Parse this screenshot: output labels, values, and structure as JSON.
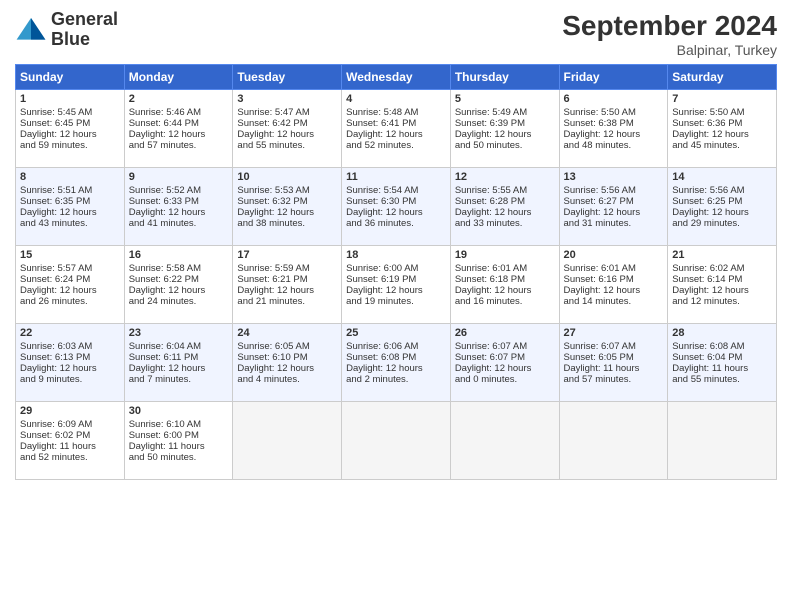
{
  "header": {
    "logo_line1": "General",
    "logo_line2": "Blue",
    "month": "September 2024",
    "location": "Balpinar, Turkey"
  },
  "days_of_week": [
    "Sunday",
    "Monday",
    "Tuesday",
    "Wednesday",
    "Thursday",
    "Friday",
    "Saturday"
  ],
  "weeks": [
    [
      {
        "day": "1",
        "lines": [
          "Sunrise: 5:45 AM",
          "Sunset: 6:45 PM",
          "Daylight: 12 hours",
          "and 59 minutes."
        ]
      },
      {
        "day": "2",
        "lines": [
          "Sunrise: 5:46 AM",
          "Sunset: 6:44 PM",
          "Daylight: 12 hours",
          "and 57 minutes."
        ]
      },
      {
        "day": "3",
        "lines": [
          "Sunrise: 5:47 AM",
          "Sunset: 6:42 PM",
          "Daylight: 12 hours",
          "and 55 minutes."
        ]
      },
      {
        "day": "4",
        "lines": [
          "Sunrise: 5:48 AM",
          "Sunset: 6:41 PM",
          "Daylight: 12 hours",
          "and 52 minutes."
        ]
      },
      {
        "day": "5",
        "lines": [
          "Sunrise: 5:49 AM",
          "Sunset: 6:39 PM",
          "Daylight: 12 hours",
          "and 50 minutes."
        ]
      },
      {
        "day": "6",
        "lines": [
          "Sunrise: 5:50 AM",
          "Sunset: 6:38 PM",
          "Daylight: 12 hours",
          "and 48 minutes."
        ]
      },
      {
        "day": "7",
        "lines": [
          "Sunrise: 5:50 AM",
          "Sunset: 6:36 PM",
          "Daylight: 12 hours",
          "and 45 minutes."
        ]
      }
    ],
    [
      {
        "day": "8",
        "lines": [
          "Sunrise: 5:51 AM",
          "Sunset: 6:35 PM",
          "Daylight: 12 hours",
          "and 43 minutes."
        ]
      },
      {
        "day": "9",
        "lines": [
          "Sunrise: 5:52 AM",
          "Sunset: 6:33 PM",
          "Daylight: 12 hours",
          "and 41 minutes."
        ]
      },
      {
        "day": "10",
        "lines": [
          "Sunrise: 5:53 AM",
          "Sunset: 6:32 PM",
          "Daylight: 12 hours",
          "and 38 minutes."
        ]
      },
      {
        "day": "11",
        "lines": [
          "Sunrise: 5:54 AM",
          "Sunset: 6:30 PM",
          "Daylight: 12 hours",
          "and 36 minutes."
        ]
      },
      {
        "day": "12",
        "lines": [
          "Sunrise: 5:55 AM",
          "Sunset: 6:28 PM",
          "Daylight: 12 hours",
          "and 33 minutes."
        ]
      },
      {
        "day": "13",
        "lines": [
          "Sunrise: 5:56 AM",
          "Sunset: 6:27 PM",
          "Daylight: 12 hours",
          "and 31 minutes."
        ]
      },
      {
        "day": "14",
        "lines": [
          "Sunrise: 5:56 AM",
          "Sunset: 6:25 PM",
          "Daylight: 12 hours",
          "and 29 minutes."
        ]
      }
    ],
    [
      {
        "day": "15",
        "lines": [
          "Sunrise: 5:57 AM",
          "Sunset: 6:24 PM",
          "Daylight: 12 hours",
          "and 26 minutes."
        ]
      },
      {
        "day": "16",
        "lines": [
          "Sunrise: 5:58 AM",
          "Sunset: 6:22 PM",
          "Daylight: 12 hours",
          "and 24 minutes."
        ]
      },
      {
        "day": "17",
        "lines": [
          "Sunrise: 5:59 AM",
          "Sunset: 6:21 PM",
          "Daylight: 12 hours",
          "and 21 minutes."
        ]
      },
      {
        "day": "18",
        "lines": [
          "Sunrise: 6:00 AM",
          "Sunset: 6:19 PM",
          "Daylight: 12 hours",
          "and 19 minutes."
        ]
      },
      {
        "day": "19",
        "lines": [
          "Sunrise: 6:01 AM",
          "Sunset: 6:18 PM",
          "Daylight: 12 hours",
          "and 16 minutes."
        ]
      },
      {
        "day": "20",
        "lines": [
          "Sunrise: 6:01 AM",
          "Sunset: 6:16 PM",
          "Daylight: 12 hours",
          "and 14 minutes."
        ]
      },
      {
        "day": "21",
        "lines": [
          "Sunrise: 6:02 AM",
          "Sunset: 6:14 PM",
          "Daylight: 12 hours",
          "and 12 minutes."
        ]
      }
    ],
    [
      {
        "day": "22",
        "lines": [
          "Sunrise: 6:03 AM",
          "Sunset: 6:13 PM",
          "Daylight: 12 hours",
          "and 9 minutes."
        ]
      },
      {
        "day": "23",
        "lines": [
          "Sunrise: 6:04 AM",
          "Sunset: 6:11 PM",
          "Daylight: 12 hours",
          "and 7 minutes."
        ]
      },
      {
        "day": "24",
        "lines": [
          "Sunrise: 6:05 AM",
          "Sunset: 6:10 PM",
          "Daylight: 12 hours",
          "and 4 minutes."
        ]
      },
      {
        "day": "25",
        "lines": [
          "Sunrise: 6:06 AM",
          "Sunset: 6:08 PM",
          "Daylight: 12 hours",
          "and 2 minutes."
        ]
      },
      {
        "day": "26",
        "lines": [
          "Sunrise: 6:07 AM",
          "Sunset: 6:07 PM",
          "Daylight: 12 hours",
          "and 0 minutes."
        ]
      },
      {
        "day": "27",
        "lines": [
          "Sunrise: 6:07 AM",
          "Sunset: 6:05 PM",
          "Daylight: 11 hours",
          "and 57 minutes."
        ]
      },
      {
        "day": "28",
        "lines": [
          "Sunrise: 6:08 AM",
          "Sunset: 6:04 PM",
          "Daylight: 11 hours",
          "and 55 minutes."
        ]
      }
    ],
    [
      {
        "day": "29",
        "lines": [
          "Sunrise: 6:09 AM",
          "Sunset: 6:02 PM",
          "Daylight: 11 hours",
          "and 52 minutes."
        ]
      },
      {
        "day": "30",
        "lines": [
          "Sunrise: 6:10 AM",
          "Sunset: 6:00 PM",
          "Daylight: 11 hours",
          "and 50 minutes."
        ]
      },
      {
        "day": "",
        "lines": []
      },
      {
        "day": "",
        "lines": []
      },
      {
        "day": "",
        "lines": []
      },
      {
        "day": "",
        "lines": []
      },
      {
        "day": "",
        "lines": []
      }
    ]
  ]
}
